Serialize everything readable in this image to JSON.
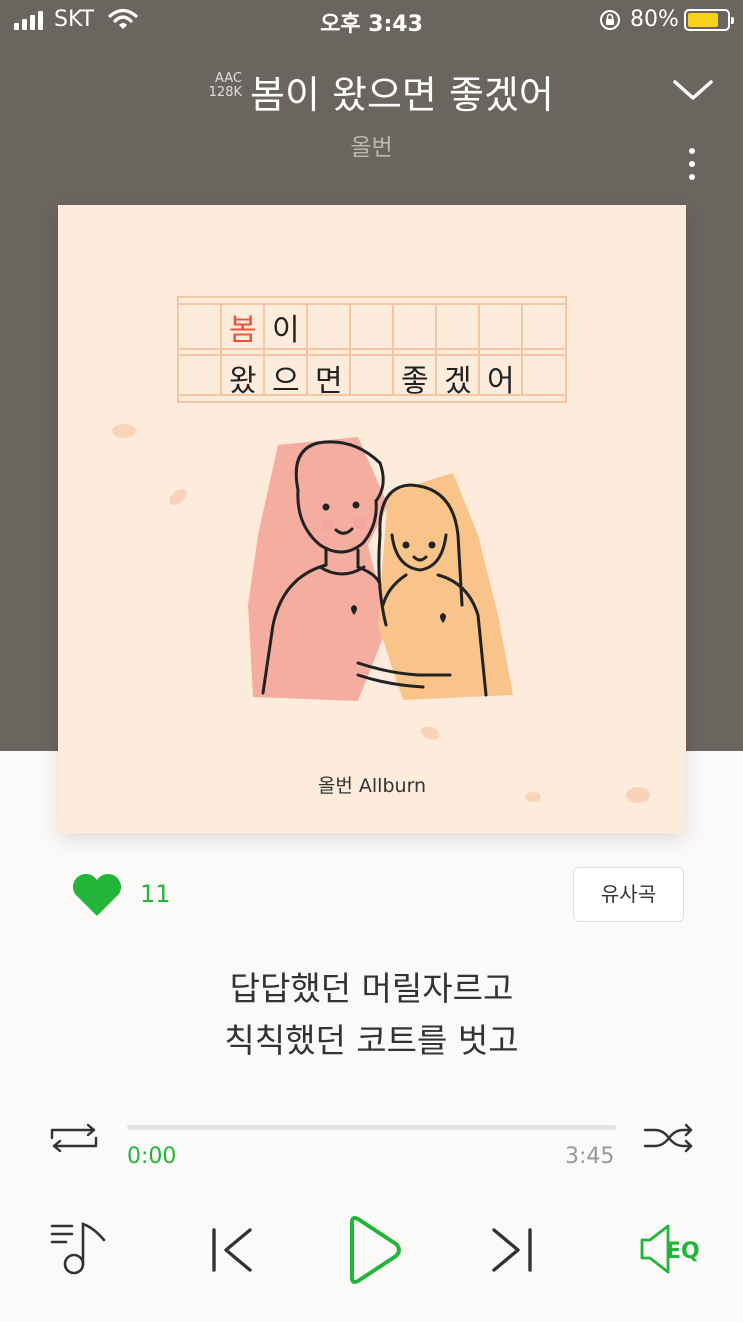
{
  "status_bar": {
    "carrier": "SKT",
    "time": "오후 3:43",
    "battery_percent": "80%",
    "battery_level": 0.8
  },
  "header": {
    "quality_line1": "AAC",
    "quality_line2": "128K",
    "title": "봄이 왔으면 좋겠어",
    "artist": "올번"
  },
  "album_art": {
    "grid_row1": [
      "봄",
      "이"
    ],
    "grid_row2": [
      "왔",
      "으",
      "면",
      "좋",
      "겠",
      "어"
    ],
    "credit": "올번 Allburn"
  },
  "like": {
    "count": "11"
  },
  "similar_button": "유사곡",
  "lyrics": {
    "line1": "답답했던 머릴자르고",
    "line2": "칙칙했던 코트를 벗고"
  },
  "playback": {
    "elapsed": "0:00",
    "duration": "3:45",
    "progress": 0
  },
  "colors": {
    "accent_green": "#22b53a",
    "header_bg": "#6b6560",
    "album_bg": "#fdecdc"
  },
  "icons": [
    "signal-icon",
    "wifi-icon",
    "rotation-lock-icon",
    "battery-icon",
    "chevron-down-icon",
    "more-vertical-icon",
    "heart-icon",
    "repeat-icon",
    "shuffle-icon",
    "playlist-icon",
    "previous-icon",
    "play-icon",
    "next-icon",
    "eq-icon"
  ]
}
